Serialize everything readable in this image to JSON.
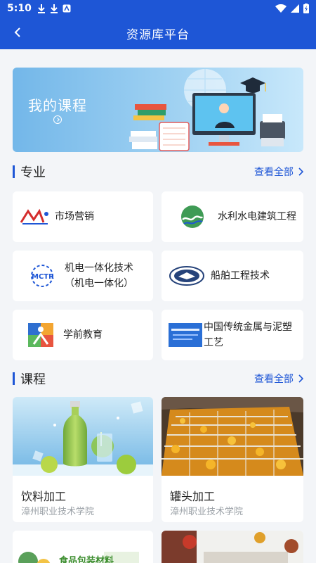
{
  "status": {
    "time": "5:10"
  },
  "appbar": {
    "title": "资源库平台"
  },
  "banner": {
    "title": "我的课程"
  },
  "majors": {
    "title": "专业",
    "view_all": "查看全部",
    "items": [
      {
        "label": "市场营销",
        "icon": "marketing-logo"
      },
      {
        "label": "水利水电建筑工程",
        "icon": "water-engineering-logo"
      },
      {
        "label": "机电一体化技术（机电一体化）",
        "icon": "mechatronics-logo"
      },
      {
        "label": "船舶工程技术",
        "icon": "ship-logo"
      },
      {
        "label": "学前教育",
        "icon": "preschool-logo"
      },
      {
        "label": "中国传统金属与泥塑工艺",
        "icon": "craft-logo"
      }
    ]
  },
  "courses": {
    "title": "课程",
    "view_all": "查看全部",
    "items": [
      {
        "title": "饮料加工",
        "school": "漳州职业技术学院"
      },
      {
        "title": "罐头加工",
        "school": "漳州职业技术学院"
      },
      {
        "title": "食品包装材料"
      },
      {
        "title": ""
      }
    ]
  },
  "colors": {
    "primary": "#1e56d6",
    "background": "#f3f5f8"
  }
}
